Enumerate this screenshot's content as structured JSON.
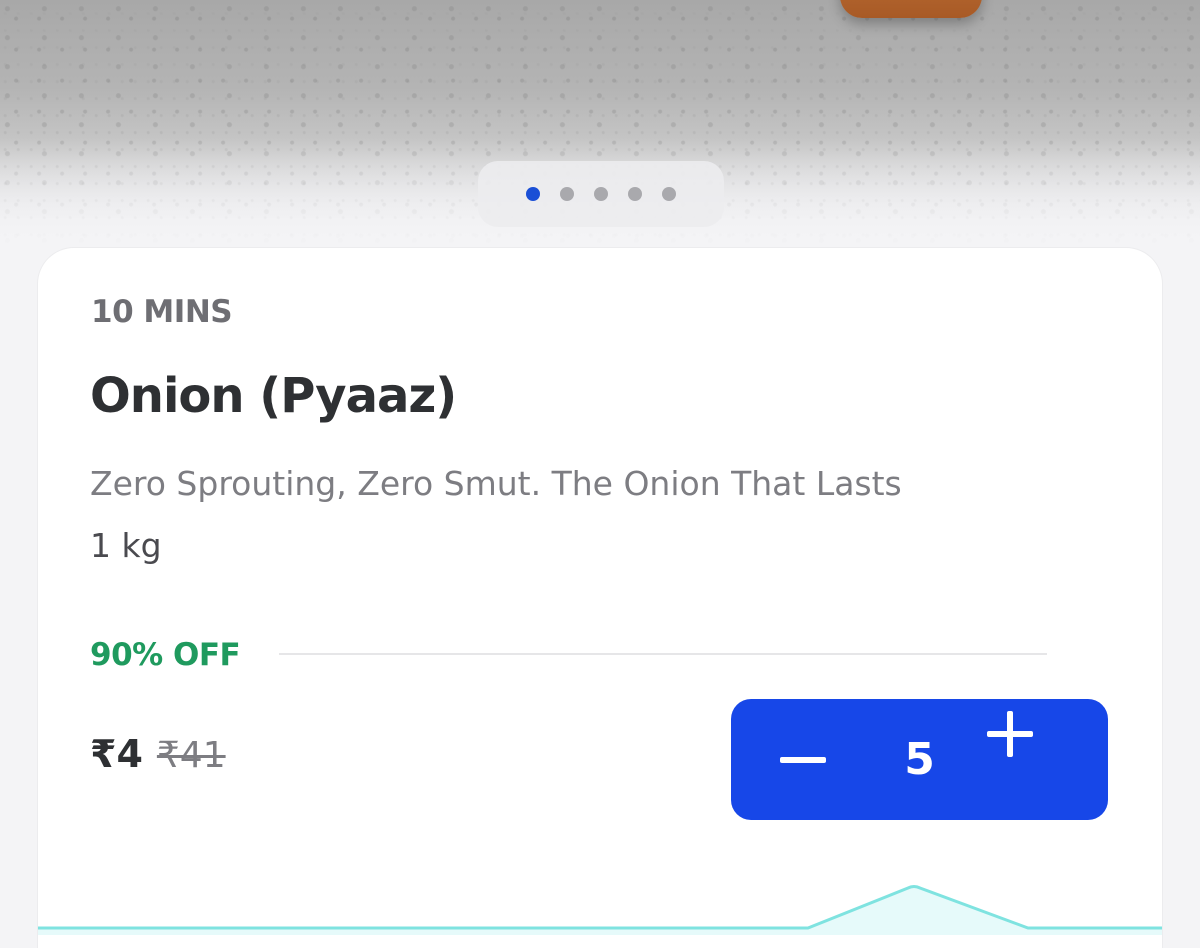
{
  "carousel": {
    "total": 5,
    "active_index": 0
  },
  "product": {
    "delivery_time": "10 MINS",
    "title": "Onion (Pyaaz)",
    "description": "Zero Sprouting, Zero Smut. The Onion That Lasts",
    "quantity": "1 kg",
    "discount": "90% OFF",
    "price": "₹4",
    "mrp": "₹41"
  },
  "cart_stepper": {
    "count": "5",
    "decrement_icon": "minus-icon",
    "increment_icon": "plus-icon"
  },
  "colors": {
    "accent": "#1747e8",
    "discount": "#1f9a5e",
    "active_dot": "#1a4fd6",
    "wave": "#7fe3e0"
  }
}
